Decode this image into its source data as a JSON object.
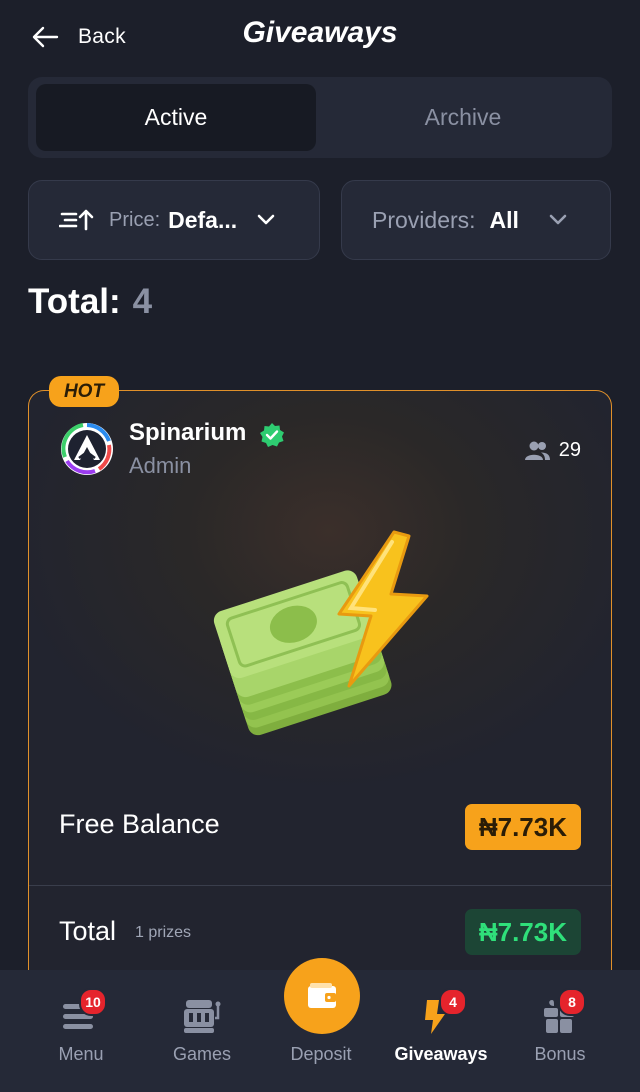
{
  "header": {
    "back_label": "Back",
    "title": "Giveaways"
  },
  "tabs": [
    {
      "label": "Active",
      "selected": true
    },
    {
      "label": "Archive",
      "selected": false
    }
  ],
  "filters": {
    "price": {
      "label": "Price:",
      "value": "Defa..."
    },
    "providers": {
      "label": "Providers:",
      "value": "All"
    }
  },
  "summary": {
    "total_label": "Total:",
    "total_count": "4"
  },
  "giveaway": {
    "badge": "HOT",
    "host_name": "Spinarium",
    "host_role": "Admin",
    "participants": "29",
    "prize_name": "Free Balance",
    "prize_value": "₦7.73K",
    "total_label": "Total",
    "prize_count": "1 prizes",
    "total_value": "₦7.73K"
  },
  "colors": {
    "accent": "#f7a21b",
    "background": "#1c1f2a",
    "panel": "#252937",
    "success": "#2fe07a",
    "badge_red": "#e5242c"
  },
  "nav": {
    "items": [
      {
        "label": "Menu",
        "icon": "menu-icon",
        "badge": "10",
        "active": false
      },
      {
        "label": "Games",
        "icon": "slot-machine-icon",
        "badge": "",
        "active": false
      },
      {
        "label": "Deposit",
        "icon": "wallet-icon",
        "badge": "",
        "active": false
      },
      {
        "label": "Giveaways",
        "icon": "lightning-icon",
        "badge": "4",
        "active": true
      },
      {
        "label": "Bonus",
        "icon": "gift-icon",
        "badge": "8",
        "active": false
      }
    ]
  }
}
